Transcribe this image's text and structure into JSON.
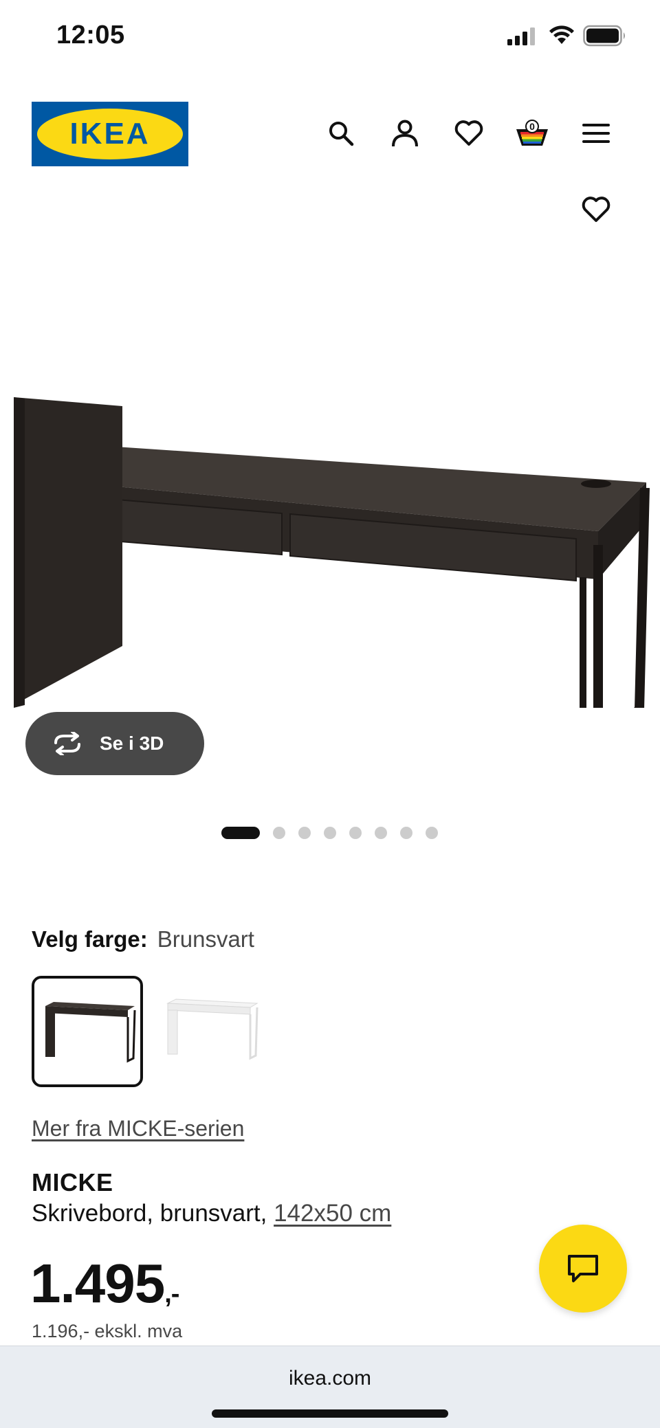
{
  "status_bar": {
    "time": "12:05"
  },
  "header": {
    "logo_text": "IKEA",
    "cart_count": "0"
  },
  "gallery": {
    "view_3d_label": "Se i 3D",
    "dots_total": 8,
    "active_dot": 1
  },
  "color": {
    "label": "Velg farge:",
    "value": "Brunsvart",
    "options": [
      "Brunsvart",
      "Hvit"
    ]
  },
  "series_link": "Mer fra MICKE-serien",
  "product": {
    "name": "MICKE",
    "description": "Skrivebord, brunsvart, ",
    "size": "142x50 cm",
    "price_main": "1.495",
    "price_suffix": ",-",
    "price_ex_vat": "1.196,- ekskl. mva"
  },
  "browser": {
    "url": "ikea.com"
  },
  "colors": {
    "brand_blue": "#0058a3",
    "brand_yellow": "#fbd914",
    "desk_dark": "#3a3531"
  }
}
